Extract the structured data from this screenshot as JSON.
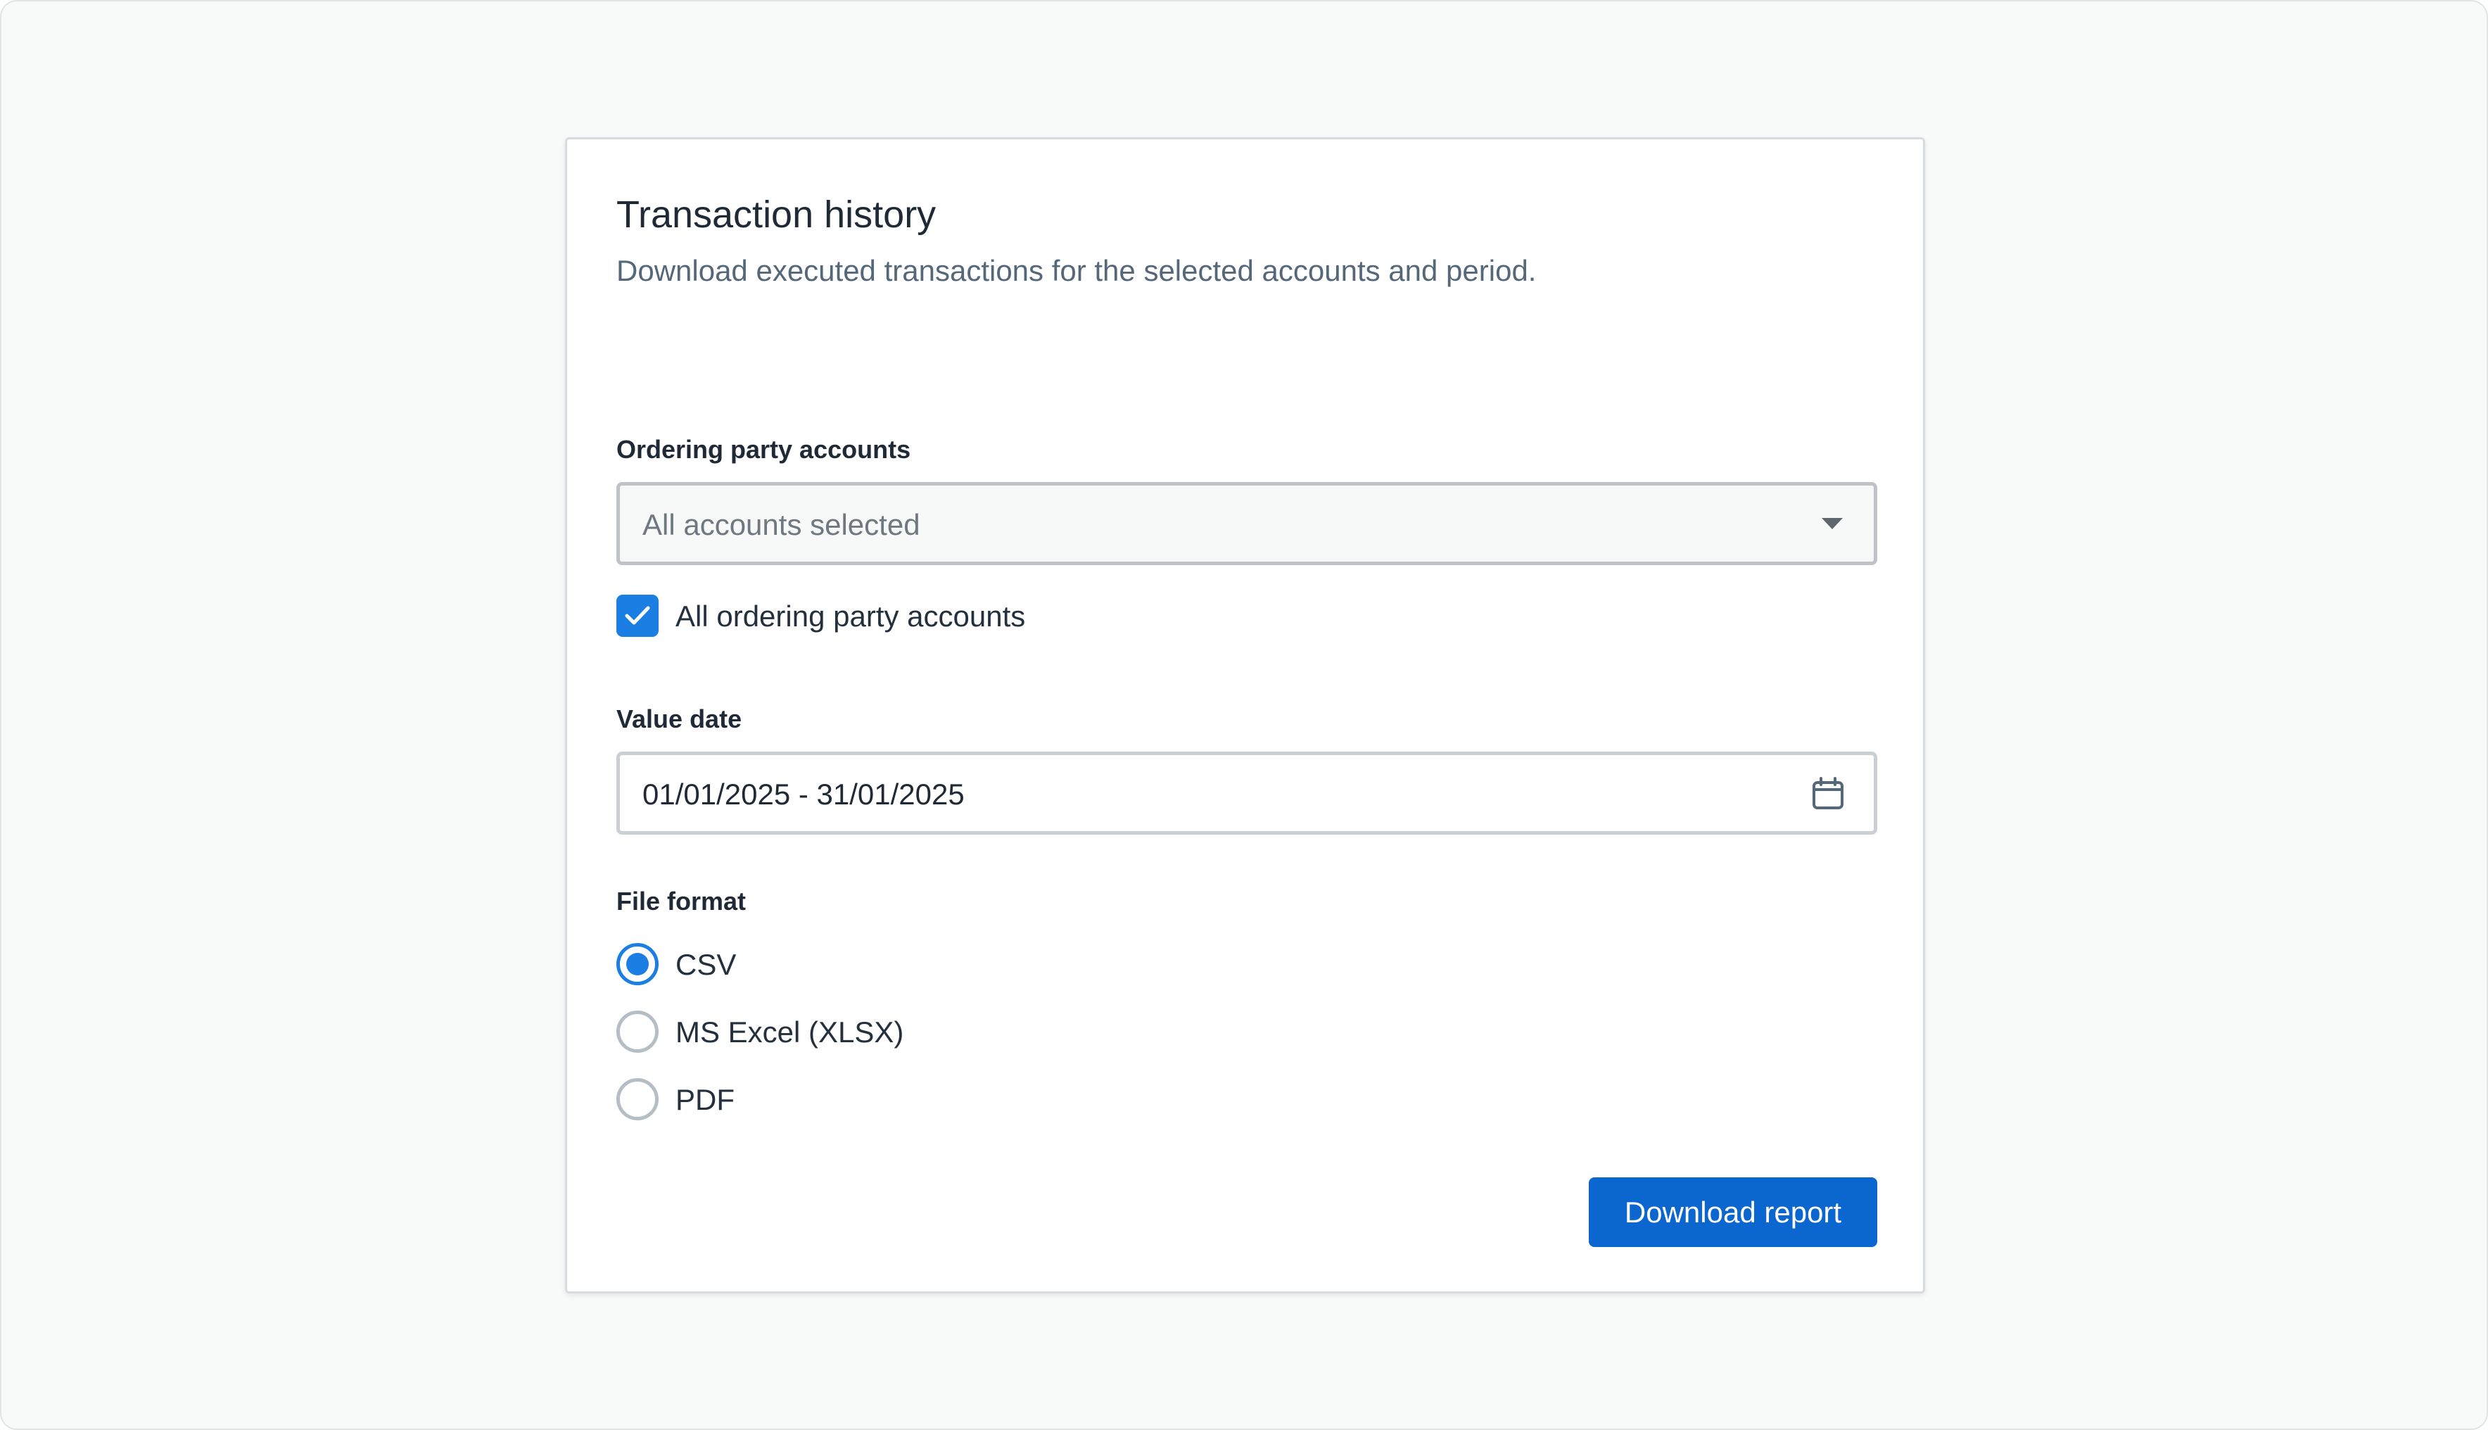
{
  "card": {
    "title": "Transaction history",
    "subtitle": "Download executed transactions for the selected accounts and period."
  },
  "accounts": {
    "label": "Ordering party accounts",
    "select_value": "All accounts selected",
    "select_icon": "caret-down-icon",
    "checkbox_label": "All ordering party accounts",
    "checkbox_checked": true,
    "checkbox_icon": "check-icon"
  },
  "value_date": {
    "label": "Value date",
    "value": "01/01/2025 - 31/01/2025",
    "icon": "calendar-icon"
  },
  "file_format": {
    "label": "File format",
    "options": [
      {
        "label": "CSV",
        "selected": true
      },
      {
        "label": "MS Excel (XLSX)",
        "selected": false
      },
      {
        "label": "PDF",
        "selected": false
      }
    ]
  },
  "actions": {
    "download_label": "Download report"
  },
  "colors": {
    "primary": "#0b66d0",
    "checkbox_accent": "#1a7ee3",
    "page_background": "#f8f9f9",
    "card_background": "#ffffff"
  }
}
